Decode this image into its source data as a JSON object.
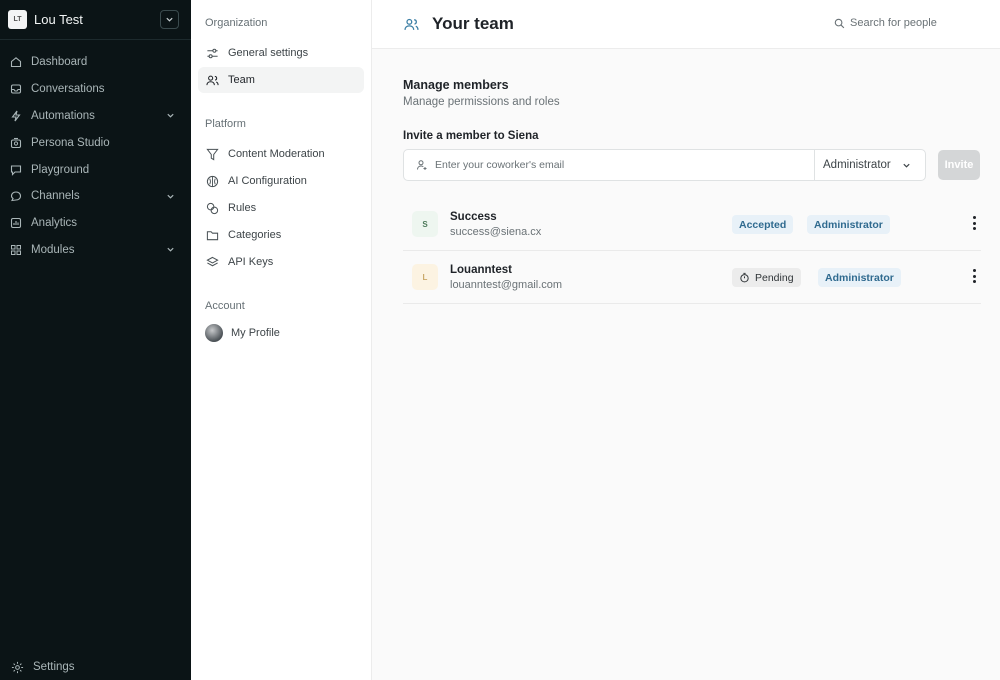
{
  "workspace": {
    "initials": "LT",
    "name": "Lou Test"
  },
  "sidebar": {
    "items": [
      {
        "label": "Dashboard"
      },
      {
        "label": "Conversations"
      },
      {
        "label": "Automations"
      },
      {
        "label": "Persona Studio"
      },
      {
        "label": "Playground"
      },
      {
        "label": "Channels"
      },
      {
        "label": "Analytics"
      },
      {
        "label": "Modules"
      }
    ],
    "settings_label": "Settings"
  },
  "subnav": {
    "organization_title": "Organization",
    "organization_items": [
      {
        "label": "General settings"
      },
      {
        "label": "Team"
      }
    ],
    "platform_title": "Platform",
    "platform_items": [
      {
        "label": "Content Moderation"
      },
      {
        "label": "AI Configuration"
      },
      {
        "label": "Rules"
      },
      {
        "label": "Categories"
      },
      {
        "label": "API Keys"
      }
    ],
    "account_title": "Account",
    "account_items": [
      {
        "label": "My Profile"
      }
    ]
  },
  "header": {
    "title": "Your team",
    "search_placeholder": "Search for people"
  },
  "manage": {
    "title": "Manage members",
    "subtitle": "Manage permissions and roles"
  },
  "invite": {
    "title": "Invite a member to Siena",
    "email_placeholder": "Enter your coworker's email",
    "role": "Administrator",
    "button": "Invite"
  },
  "members": [
    {
      "initial": "S",
      "name": "Success",
      "email": "success@siena.cx",
      "status": "Accepted",
      "role": "Administrator"
    },
    {
      "initial": "L",
      "name": "Louanntest",
      "email": "louanntest@gmail.com",
      "status": "Pending",
      "role": "Administrator"
    }
  ],
  "colors": {
    "sidebar_bg": "#0b1416",
    "badge_bg": "#e8f1f8",
    "badge_text": "#2f6a8f",
    "invite_disabled": "#d4d6d7"
  }
}
